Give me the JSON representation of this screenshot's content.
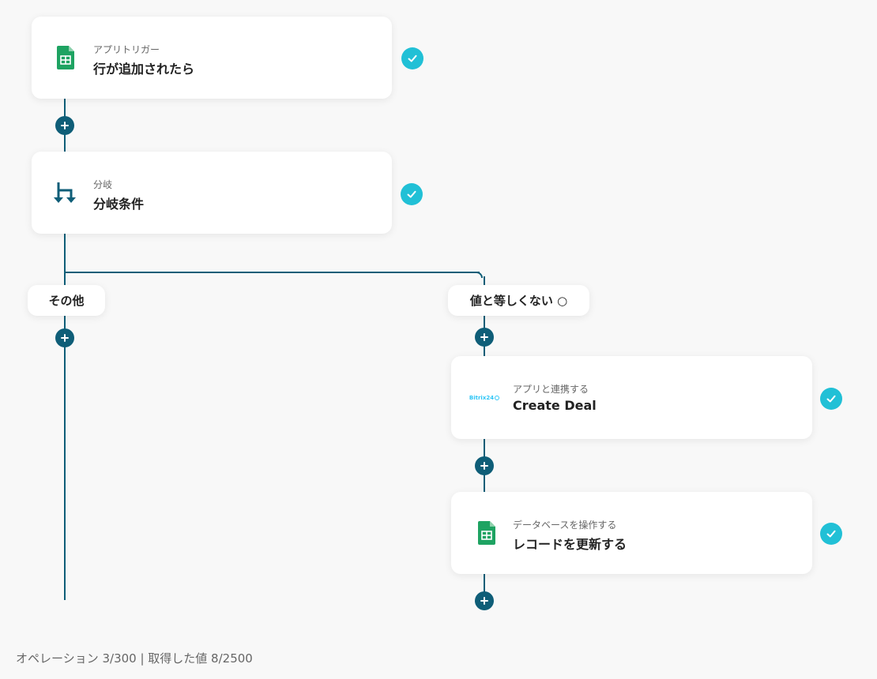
{
  "nodes": {
    "trigger": {
      "subtitle": "アプリトリガー",
      "title": "行が追加されたら",
      "icon": "google-sheets-icon"
    },
    "branch": {
      "subtitle": "分岐",
      "title": "分岐条件",
      "icon": "branch-icon"
    },
    "create_deal": {
      "subtitle": "アプリと連携する",
      "title": "Create Deal",
      "icon": "bitrix24-logo",
      "logo_text": "Bitrix24"
    },
    "update_record": {
      "subtitle": "データベースを操作する",
      "title": "レコードを更新する",
      "icon": "google-sheets-icon"
    }
  },
  "branches": {
    "left_label": "その他",
    "right_label": "値と等しくない ○"
  },
  "footer": {
    "status": "オペレーション 3/300 | 取得した値 8/2500"
  },
  "colors": {
    "connector": "#0f5e78",
    "check": "#21c0d6",
    "sheets_green": "#1ea362",
    "background": "#f8f8f8"
  }
}
